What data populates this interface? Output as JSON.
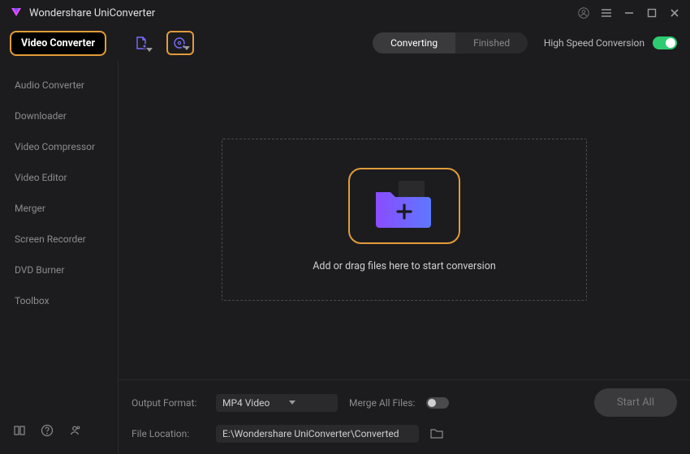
{
  "app": {
    "title": "Wondershare UniConverter"
  },
  "toolbar": {
    "activeTool": "Video Converter",
    "tabs": {
      "converting": "Converting",
      "finished": "Finished"
    },
    "highSpeedLabel": "High Speed Conversion",
    "highSpeedOn": true
  },
  "sidebar": {
    "items": [
      "Audio Converter",
      "Downloader",
      "Video Compressor",
      "Video Editor",
      "Merger",
      "Screen Recorder",
      "DVD Burner",
      "Toolbox"
    ]
  },
  "dropzone": {
    "text": "Add or drag files here to start conversion"
  },
  "footer": {
    "outputFormatLabel": "Output Format:",
    "outputFormatValue": "MP4 Video",
    "mergeLabel": "Merge All Files:",
    "mergeOn": false,
    "fileLocationLabel": "File Location:",
    "fileLocationValue": "E:\\Wondershare UniConverter\\Converted",
    "startAll": "Start All"
  },
  "colors": {
    "accent": "#e29b3a",
    "folderA": "#7a4cff",
    "folderB": "#5d78ff",
    "toggleOn": "#2ecc71"
  }
}
